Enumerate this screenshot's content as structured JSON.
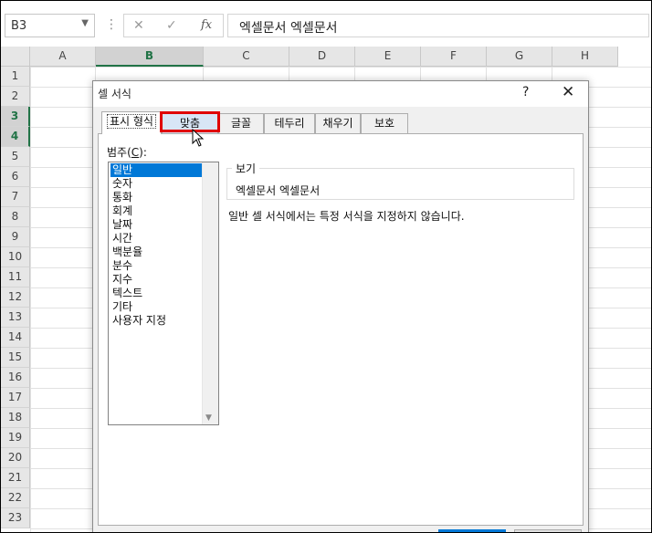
{
  "formula_bar": {
    "name_box": "B3",
    "dropdown_icon": "chevron-down-icon",
    "more_icon": "vertical-dots-icon",
    "cancel_icon": "x-icon",
    "cancel_glyph": "✕",
    "enter_icon": "check-icon",
    "enter_glyph": "✓",
    "fx_label": "fx",
    "content": "엑셀문서 엑셀문서"
  },
  "sheet": {
    "columns": [
      "A",
      "B",
      "C",
      "D",
      "E",
      "F",
      "G",
      "H"
    ],
    "selected_column": "B",
    "rows": [
      "1",
      "2",
      "3",
      "4",
      "5",
      "6",
      "7",
      "8",
      "9",
      "10",
      "11",
      "12",
      "13",
      "14",
      "15",
      "16",
      "17",
      "18",
      "19",
      "20",
      "21",
      "22",
      "23"
    ],
    "selected_rows": [
      "3",
      "4"
    ]
  },
  "dialog": {
    "title": "셀 서식",
    "help_label": "?",
    "close_label": "✕",
    "tabs": [
      {
        "label": "표시 형식",
        "active": true
      },
      {
        "label": "맞춤",
        "highlighted": true
      },
      {
        "label": "글꼴"
      },
      {
        "label": "테두리"
      },
      {
        "label": "채우기"
      },
      {
        "label": "보호"
      }
    ],
    "category_label_prefix": "범주(",
    "category_label_key": "C",
    "category_label_suffix": "):",
    "categories": [
      "일반",
      "숫자",
      "통화",
      "회계",
      "날짜",
      "시간",
      "백분율",
      "분수",
      "지수",
      "텍스트",
      "기타",
      "사용자 지정"
    ],
    "selected_category": "일반",
    "sample_legend": "보기",
    "sample_value": "엑셀문서 엑셀문서",
    "description": "일반 셀 서식에서는 특정 서식을 지정하지 않습니다.",
    "highlight_color": "#e00000",
    "selection_color": "#0078d7"
  }
}
